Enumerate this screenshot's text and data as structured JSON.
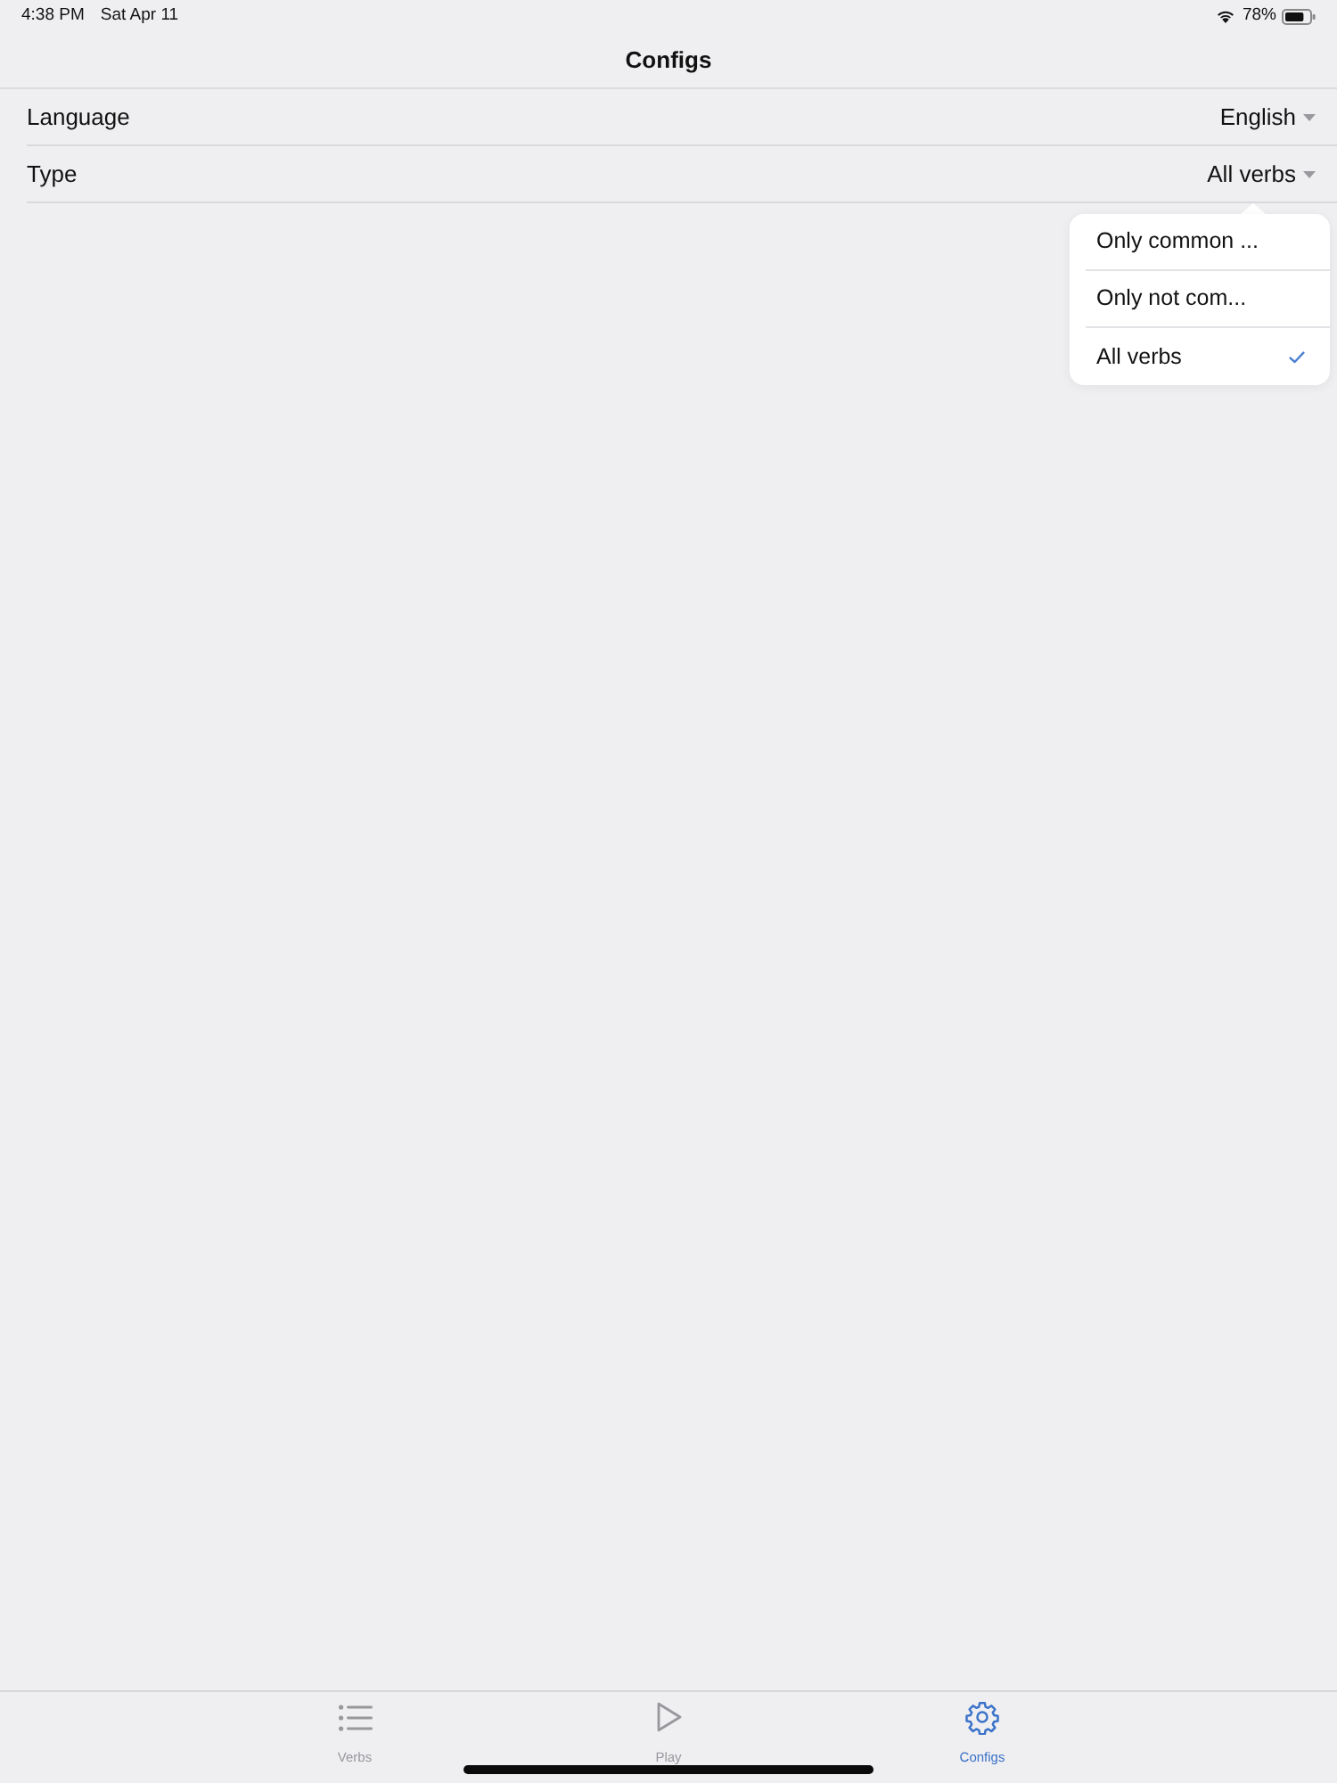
{
  "status_bar": {
    "time": "4:38 PM",
    "date": "Sat Apr 11",
    "battery": "78%"
  },
  "navigation_bar": {
    "title": "Configs"
  },
  "settings": [
    {
      "label": "Language",
      "value": "English"
    },
    {
      "label": "Type",
      "value": "All verbs"
    }
  ],
  "dropdown_menu": {
    "options": [
      {
        "label": "Only common ...",
        "selected": false
      },
      {
        "label": "Only not com...",
        "selected": false
      },
      {
        "label": "All verbs",
        "selected": true
      }
    ]
  },
  "tab_bar": {
    "tabs": [
      {
        "label": "Verbs",
        "kind": "list",
        "selected": false
      },
      {
        "label": "Play",
        "kind": "play",
        "selected": false
      },
      {
        "label": "Configs",
        "kind": "gear",
        "selected": true
      }
    ]
  }
}
